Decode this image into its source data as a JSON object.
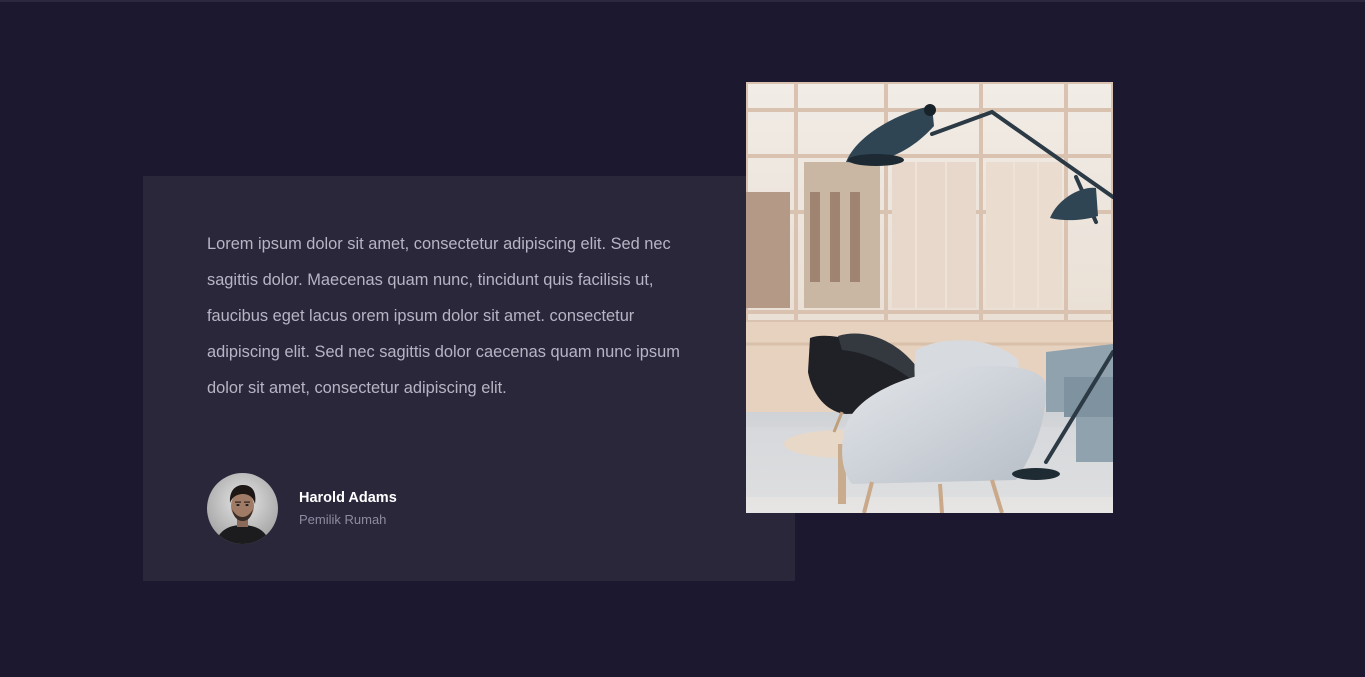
{
  "testimonial": {
    "quote": "Lorem ipsum dolor sit amet, consectetur adipiscing elit. Sed nec sagittis dolor. Maecenas quam nunc, tincidunt quis facilisis ut, faucibus eget lacus orem ipsum dolor sit amet. consectetur adipiscing elit. Sed nec sagittis dolor caecenas quam nunc ipsum dolor sit amet, consectetur adipiscing elit.",
    "author_name": "Harold Adams",
    "author_role": "Pemilik Rumah"
  },
  "colors": {
    "page_background": "#1b1830",
    "card_background": "#2a273b",
    "quote_text": "#b7b4c4",
    "name_text": "#ffffff",
    "role_text": "#8e8ba0"
  }
}
